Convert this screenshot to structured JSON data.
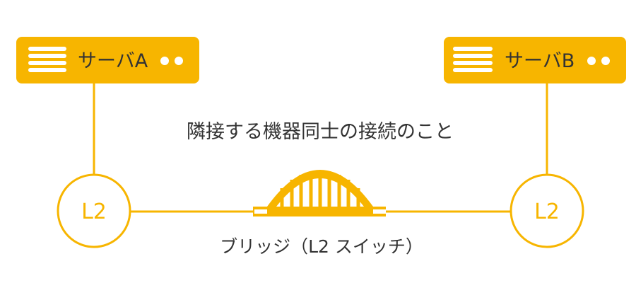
{
  "colors": {
    "accent": "#F7B500",
    "text": "#333333",
    "bg": "#FFFFFF"
  },
  "server_a": {
    "label": "サーバA",
    "icon": "server-icon"
  },
  "server_b": {
    "label": "サーバB",
    "icon": "server-icon"
  },
  "caption": "隣接する機器同士の接続のこと",
  "node_left": {
    "label": "L2"
  },
  "node_right": {
    "label": "L2"
  },
  "bridge": {
    "label": "ブリッジ（L2 スイッチ）",
    "icon": "bridge-icon"
  }
}
